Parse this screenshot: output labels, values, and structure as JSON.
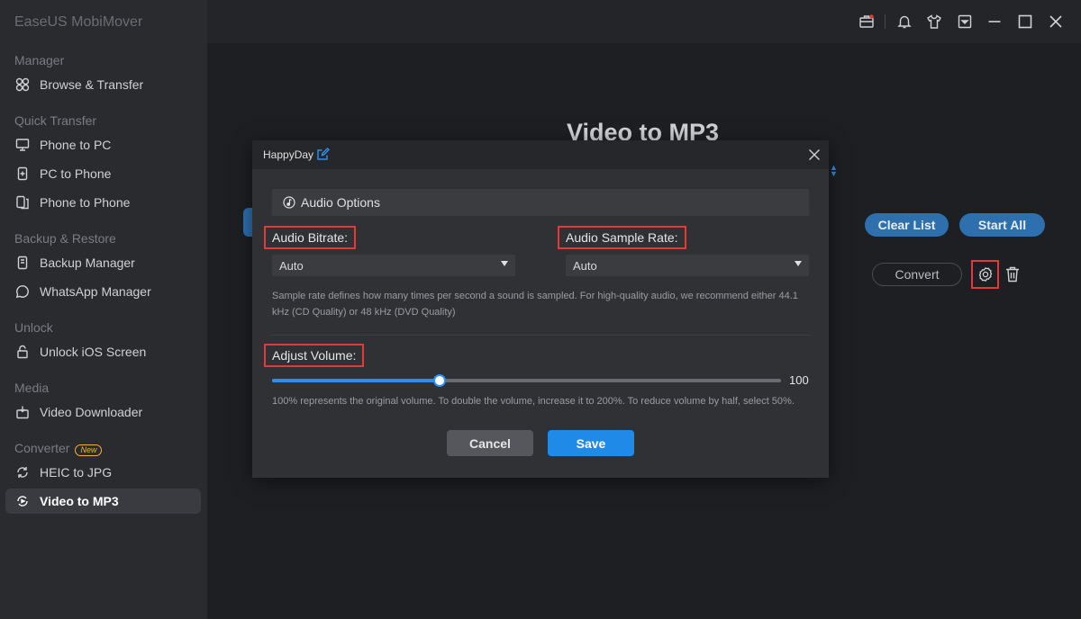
{
  "app": {
    "title": "EaseUS MobiMover"
  },
  "sidebar": {
    "sections": [
      {
        "label": "Manager",
        "items": [
          {
            "label": "Browse & Transfer",
            "icon": "grid-icon"
          }
        ]
      },
      {
        "label": "Quick Transfer",
        "items": [
          {
            "label": "Phone to PC",
            "icon": "monitor-icon"
          },
          {
            "label": "PC to Phone",
            "icon": "phone-plus-icon"
          },
          {
            "label": "Phone to Phone",
            "icon": "phones-icon"
          }
        ]
      },
      {
        "label": "Backup & Restore",
        "items": [
          {
            "label": "Backup Manager",
            "icon": "backup-icon"
          },
          {
            "label": "WhatsApp Manager",
            "icon": "whatsapp-icon"
          }
        ]
      },
      {
        "label": "Unlock",
        "items": [
          {
            "label": "Unlock iOS Screen",
            "icon": "lock-icon"
          }
        ]
      },
      {
        "label": "Media",
        "items": [
          {
            "label": "Video Downloader",
            "icon": "download-icon"
          }
        ]
      },
      {
        "label": "Converter",
        "badge": "New",
        "items": [
          {
            "label": "HEIC to JPG",
            "icon": "convert-icon"
          },
          {
            "label": "Video to MP3",
            "icon": "video-convert-icon",
            "active": true
          }
        ]
      }
    ]
  },
  "main": {
    "title": "Video to MP3",
    "clear_list": "Clear List",
    "start_all": "Start All",
    "convert": "Convert"
  },
  "dialog": {
    "title": "HappyDay",
    "section": "Audio Options",
    "bitrate_label": "Audio Bitrate:",
    "bitrate_value": "Auto",
    "sample_rate_label": "Audio Sample Rate:",
    "sample_rate_value": "Auto",
    "sample_hint_line1": "Sample rate defines how many times per second a sound is sampled. For high-quality audio, we recommend either 44.1",
    "sample_hint_line2": "kHz (CD Quality) or 48 kHz (DVD Quality)",
    "volume_label": "Adjust Volume:",
    "volume_value": "100",
    "volume_fraction": 0.33,
    "volume_hint": "100% represents the original volume. To double the volume, increase it to 200%. To reduce volume by half, select 50%.",
    "cancel": "Cancel",
    "save": "Save"
  },
  "colors": {
    "accent": "#1f8ae8",
    "highlight": "#e53935",
    "badge": "#f0b13a"
  }
}
